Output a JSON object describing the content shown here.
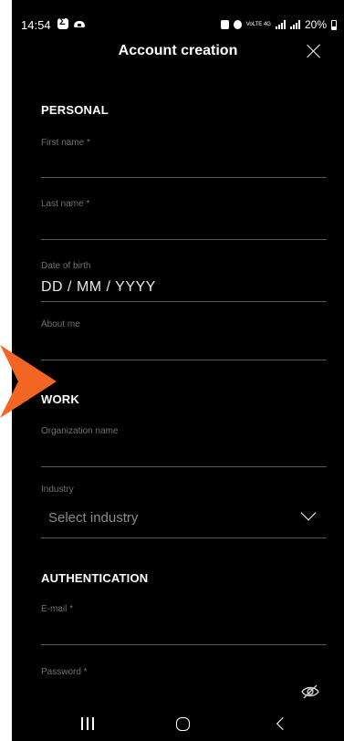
{
  "status_bar": {
    "time": "14:54",
    "network": "VoLTE 4G",
    "battery": "20%"
  },
  "header": {
    "title": "Account creation"
  },
  "sections": {
    "personal": "PERSONAL",
    "work": "WORK",
    "authentication": "AUTHENTICATION"
  },
  "fields": {
    "first_name": {
      "label": "First name *",
      "value": ""
    },
    "last_name": {
      "label": "Last name *",
      "value": ""
    },
    "date_of_birth": {
      "label": "Date of birth",
      "placeholder": "DD / MM / YYYY"
    },
    "about_me": {
      "label": "About me",
      "value": ""
    },
    "organization": {
      "label": "Organization name",
      "value": ""
    },
    "industry": {
      "label": "Industry",
      "selected": "Select industry"
    },
    "email": {
      "label": "E-mail *",
      "value": ""
    },
    "password": {
      "label": "Password *",
      "value": ""
    }
  },
  "icons": {
    "close": "close-icon",
    "industry_dropdown": "chevron-down-icon",
    "password_toggle": "eye-off-icon",
    "nav_recent": "recent-apps-icon",
    "nav_home": "home-icon",
    "nav_back": "back-icon"
  },
  "colors": {
    "background": "#000000",
    "text": "#ffffff",
    "label": "#707070",
    "underline": "#5a5a5a",
    "marker": "#f26522"
  }
}
